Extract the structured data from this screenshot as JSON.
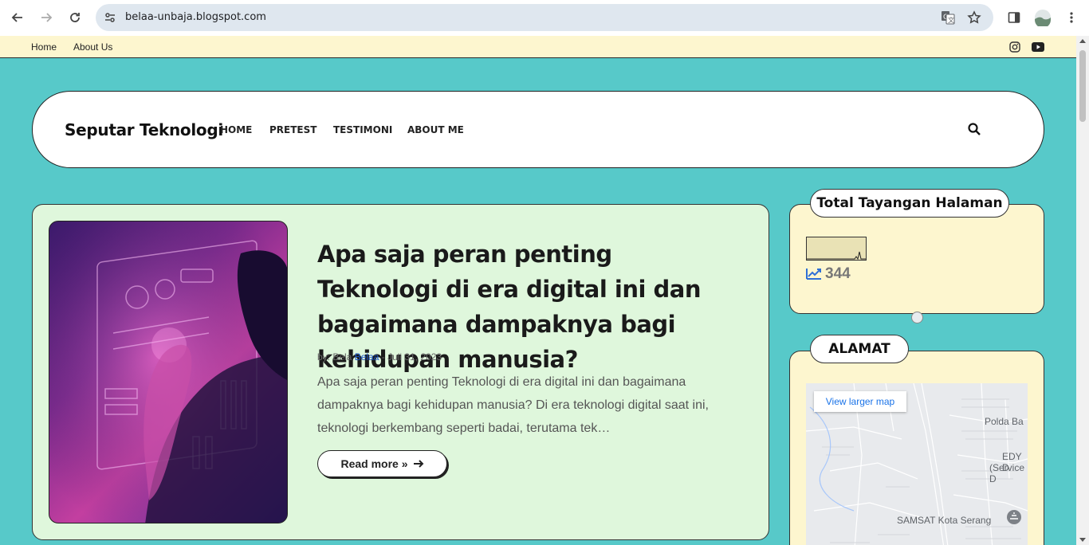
{
  "browser": {
    "url": "belaa-unbaja.blogspot.com",
    "back_icon": "back-arrow-icon",
    "forward_icon": "forward-arrow-icon",
    "reload_icon": "reload-icon",
    "site_info_icon": "site-info-icon",
    "translate_icon": "translate-icon",
    "bookmark_icon": "star-icon",
    "sidepanel_icon": "side-panel-icon",
    "profile_icon": "avatar",
    "menu_icon": "kebab-menu-icon"
  },
  "topbar": {
    "links": [
      "Home",
      "About Us"
    ],
    "social": [
      "instagram-icon",
      "youtube-icon"
    ]
  },
  "header": {
    "brand": "Seputar Teknologi",
    "menu": [
      "HOME",
      "PRETEST",
      "TESTIMONI",
      "ABOUT ME"
    ],
    "search_icon": "search-icon"
  },
  "post": {
    "title": "Apa saja peran penting Teknologi di era digital ini dan bagaimana dampaknya bagi kehidupan manusia?",
    "by_prefix": "by: Bela",
    "author": "Belaa",
    "separator": "-",
    "date": "Juli 31, 2023",
    "excerpt": "Apa saja peran penting Teknologi di era digital ini dan bagaimana dampaknya bagi kehidupan manusia?      Di era teknologi digital saat ini, teknologi berkembang seperti badai, terutama tek…",
    "read_more": "Read more »"
  },
  "widgets": {
    "pageviews": {
      "title": "Total Tayangan Halaman",
      "count": "344"
    },
    "address": {
      "title": "ALAMAT",
      "larger_map": "View larger map",
      "labels": [
        "Polda Ba",
        "EDY D",
        "(Service D",
        "SAMSAT Kota Serang"
      ]
    }
  },
  "colors": {
    "page_bg": "#57c9c9",
    "topbar_bg": "#fdf6cf",
    "post_bg": "#dff7dc",
    "widget_bg": "#fdf6cf",
    "link": "#1a56c8"
  }
}
